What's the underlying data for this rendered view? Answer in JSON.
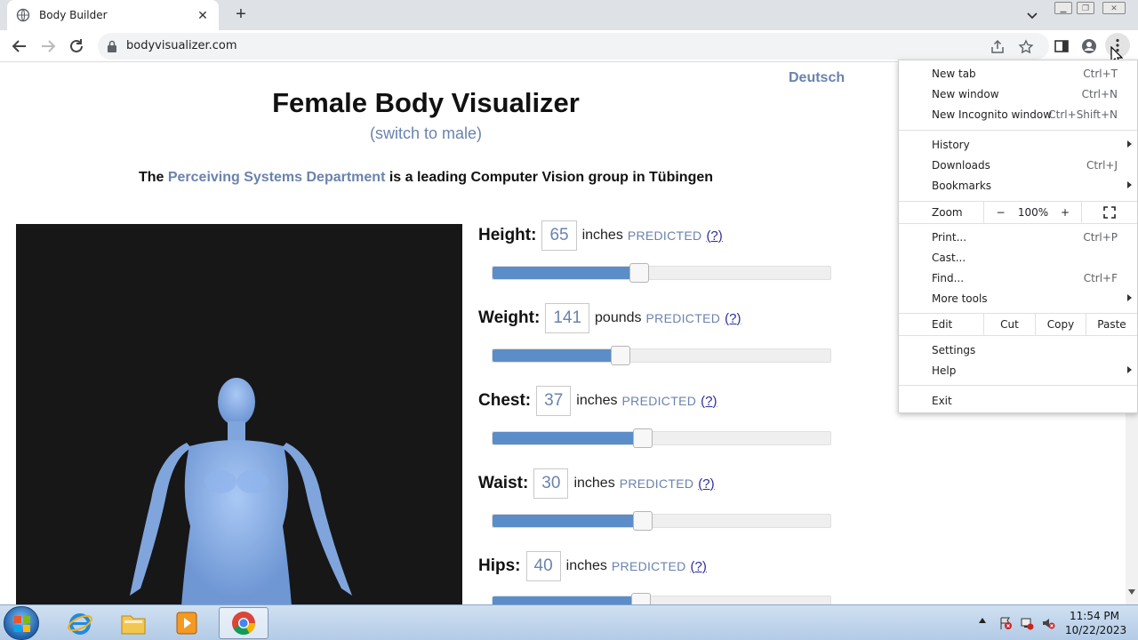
{
  "browser": {
    "tab": {
      "title": "Body Builder"
    },
    "url": "bodyvisualizer.com"
  },
  "page": {
    "language_link": "Deutsch",
    "title": "Female Body Visualizer",
    "switch_link": "(switch to male)",
    "tagline_pre": "The ",
    "tagline_link": "Perceiving Systems Department",
    "tagline_post": " is a leading Computer Vision group in Tübingen",
    "measurements": [
      {
        "label": "Height:",
        "value": "65",
        "unit": "inches",
        "status": "PREDICTED",
        "help": "(?)",
        "slider_percent": 43.5
      },
      {
        "label": "Weight:",
        "value": "141",
        "unit": "pounds",
        "status": "PREDICTED",
        "help": "(?)",
        "slider_percent": 38.0
      },
      {
        "label": "Chest:",
        "value": "37",
        "unit": "inches",
        "status": "PREDICTED",
        "help": "(?)",
        "slider_percent": 44.5
      },
      {
        "label": "Waist:",
        "value": "30",
        "unit": "inches",
        "status": "PREDICTED",
        "help": "(?)",
        "slider_percent": 44.5
      },
      {
        "label": "Hips:",
        "value": "40",
        "unit": "inches",
        "status": "PREDICTED",
        "help": "(?)",
        "slider_percent": 44.0
      }
    ]
  },
  "menu": {
    "new_tab": {
      "label": "New tab",
      "shortcut": "Ctrl+T"
    },
    "new_window": {
      "label": "New window",
      "shortcut": "Ctrl+N"
    },
    "new_incognito": {
      "label": "New Incognito window",
      "shortcut": "Ctrl+Shift+N"
    },
    "history": {
      "label": "History"
    },
    "downloads": {
      "label": "Downloads",
      "shortcut": "Ctrl+J"
    },
    "bookmarks": {
      "label": "Bookmarks"
    },
    "zoom": {
      "label": "Zoom",
      "minus": "−",
      "level": "100%",
      "plus": "+"
    },
    "print": {
      "label": "Print...",
      "shortcut": "Ctrl+P"
    },
    "cast": {
      "label": "Cast..."
    },
    "find": {
      "label": "Find...",
      "shortcut": "Ctrl+F"
    },
    "more_tools": {
      "label": "More tools"
    },
    "edit": {
      "label": "Edit",
      "cut": "Cut",
      "copy": "Copy",
      "paste": "Paste"
    },
    "settings": {
      "label": "Settings"
    },
    "help": {
      "label": "Help"
    },
    "exit": {
      "label": "Exit"
    }
  },
  "taskbar": {
    "time": "11:54 PM",
    "date": "10/22/2023"
  },
  "colors": {
    "accent_link": "#6a83ad",
    "slider_fill": "#5b8dc9",
    "body_model": "#8eb4ec"
  }
}
